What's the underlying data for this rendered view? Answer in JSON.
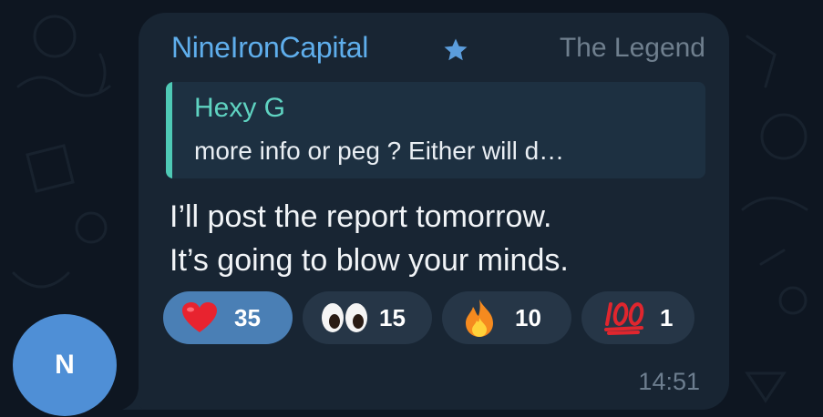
{
  "chat": {
    "avatar_letter": "N",
    "sender": {
      "name": "NineIronCapital",
      "badge_icon": "star-icon",
      "title": "The Legend"
    },
    "reply": {
      "author": "Hexy G",
      "text": "more info or peg ?   Either will d…"
    },
    "message": {
      "line1": "I’ll post the report tomorrow.",
      "line2": "It’s going to blow your minds."
    },
    "reactions": [
      {
        "icon": "heart-emoji",
        "count": "35",
        "active": true
      },
      {
        "icon": "eyes-emoji",
        "count": "15",
        "active": false
      },
      {
        "icon": "fire-emoji",
        "count": "10",
        "active": false
      },
      {
        "icon": "hundred-points-emoji",
        "count": "1",
        "active": false
      }
    ],
    "time": "14:51"
  },
  "colors": {
    "background": "#0e1621",
    "bubble": "#182533",
    "sender_name": "#5faeec",
    "reply_accent": "#4ec9b5",
    "active_reaction": "#4a7fb5",
    "reaction": "#263647",
    "avatar": "#4f8fd6"
  }
}
